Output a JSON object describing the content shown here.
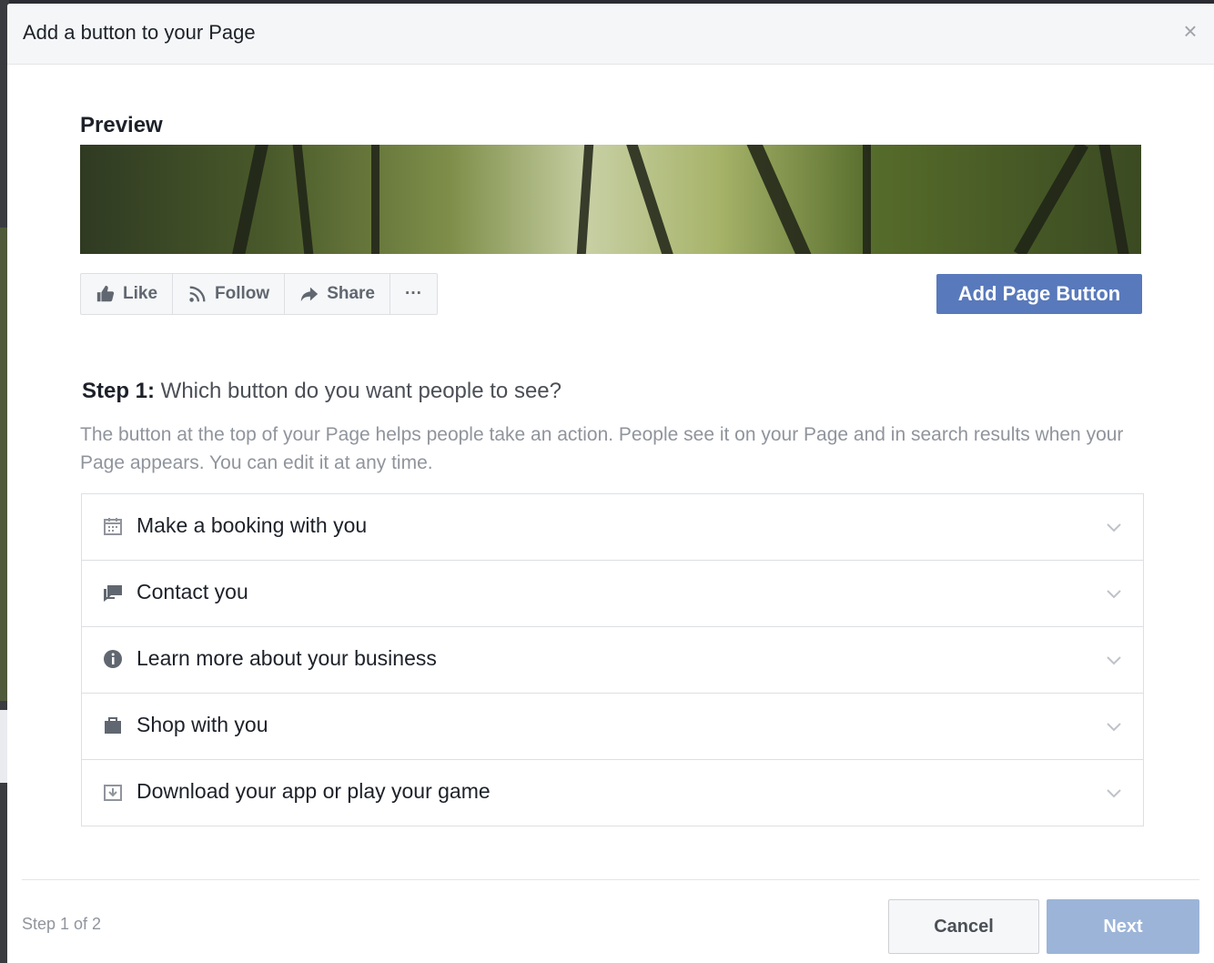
{
  "dialog": {
    "title": "Add a button to your Page",
    "close_symbol": "×"
  },
  "preview": {
    "label": "Preview",
    "actions": [
      {
        "label": "Like",
        "icon": "thumbs-up-icon"
      },
      {
        "label": "Follow",
        "icon": "rss-icon"
      },
      {
        "label": "Share",
        "icon": "share-arrow-icon"
      },
      {
        "label": "···",
        "icon": "more-icon"
      }
    ],
    "add_button_label": "Add Page Button"
  },
  "step": {
    "prefix": "Step 1:",
    "question": " Which button do you want people to see?",
    "description": "The button at the top of your Page helps people take an action. People see it on your Page and in search results when your Page appears. You can edit it at any time."
  },
  "options": [
    {
      "label": "Make a booking with you",
      "icon": "calendar-icon"
    },
    {
      "label": "Contact you",
      "icon": "chat-icon"
    },
    {
      "label": "Learn more about your business",
      "icon": "info-icon"
    },
    {
      "label": "Shop with you",
      "icon": "shopping-bag-icon"
    },
    {
      "label": "Download your app or play your game",
      "icon": "download-icon"
    }
  ],
  "footer": {
    "step_count": "Step 1 of 2",
    "cancel_label": "Cancel",
    "next_label": "Next"
  },
  "colors": {
    "brand_blue": "#4267b2",
    "next_disabled": "#9cb4d8"
  }
}
